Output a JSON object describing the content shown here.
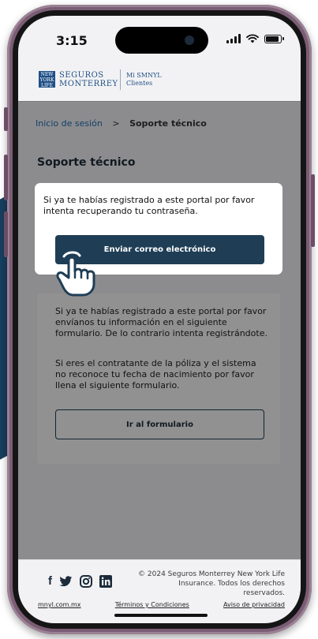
{
  "status_bar": {
    "time": "3:15"
  },
  "brand": {
    "mark": "NEW YORK LIFE",
    "line1": "SEGUROS",
    "line2": "MONTERREY",
    "sub1": "Mi SMNYL",
    "sub2": "Clientes",
    "color": "#1f4f86"
  },
  "breadcrumb": {
    "link": "Inicio de sesión",
    "separator": ">",
    "current": "Soporte técnico"
  },
  "page_title": "Soporte técnico",
  "card_recover": {
    "text": "Si ya te habías registrado a este portal por favor intenta recuperando tu contraseña.",
    "button": "Enviar correo electrónico"
  },
  "card_form": {
    "text1": "Si ya te habías registrado a este portal por favor envíanos tu información en el siguiente formulario. De lo contrario intenta registrándote.",
    "text2": "Si eres el contratante de la póliza y el sistema no reconoce tu fecha de nacimiento por favor llena el siguiente formulario.",
    "button": "Ir al formulario"
  },
  "footer": {
    "copyright": "© 2024 Seguros Monterrey New York Life Insurance. Todos los derechos reservados.",
    "links": [
      "mnyl.com.mx",
      "Términos y Condiciones",
      "Aviso de privacidad"
    ],
    "social_icons": [
      "facebook-icon",
      "twitter-icon",
      "instagram-icon",
      "linkedin-icon"
    ]
  },
  "colors": {
    "primary": "#1f3e56",
    "accent_link": "#1f6fb5",
    "phone_frame": "#7a5d74",
    "deco": "#173f5f"
  }
}
